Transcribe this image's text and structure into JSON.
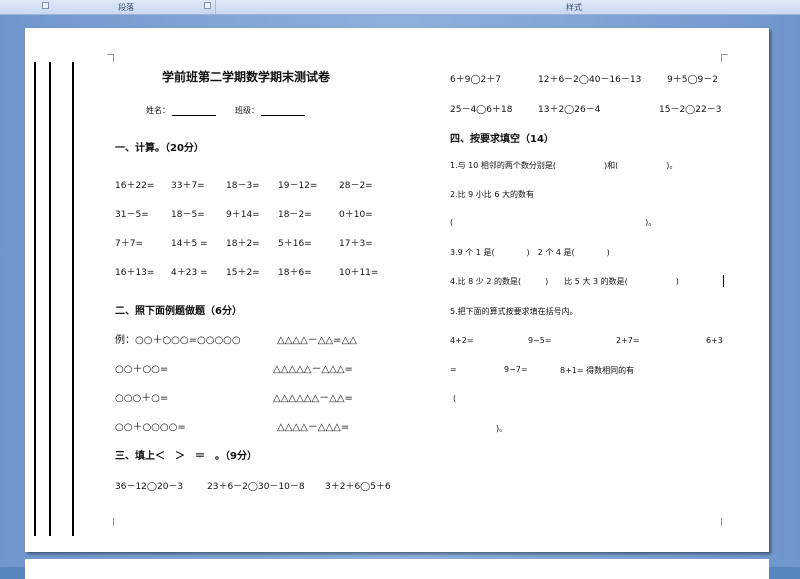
{
  "ribbon": {
    "group_paragraph": "段落",
    "group_styles": "样式"
  },
  "exam": {
    "title": "学前班第二学期数学期末测试卷",
    "name_label": "姓名：",
    "class_label": "班级：",
    "section1": {
      "heading": "一、计算。（20分）",
      "rows": [
        [
          "16＋22=",
          "33＋7=",
          "18－3=",
          "19－12=",
          "28－2="
        ],
        [
          "31－5=",
          "18－5=",
          "9＋14=",
          "18－2=",
          "0＋10="
        ],
        [
          "7＋7=",
          "14＋5 =",
          "18＋2=",
          "5＋16=",
          "17＋3="
        ],
        [
          "16＋13=",
          "4＋23 =",
          "15＋2=",
          "18＋6=",
          "10＋11="
        ]
      ]
    },
    "section2": {
      "heading": "二、照下面例题做题（6分）",
      "rows": [
        [
          "例：○○＋○○○=○○○○○",
          "△△△△－△△=△△"
        ],
        [
          "○○＋○○=",
          "△△△△△－△△△="
        ],
        [
          "○○○＋○=",
          "△△△△△△－△△="
        ],
        [
          "○○＋○○○○=",
          "△△△△－△△△="
        ]
      ]
    },
    "section3": {
      "heading": "三、填上＜　＞　＝　。（9分）",
      "row1": [
        "36－12◯20－3",
        "23＋6－2◯30－10－8",
        "3＋2＋6◯5＋6"
      ]
    },
    "right_compare": {
      "row1": [
        "6＋9◯2＋7",
        "12＋6－2◯40－16－13",
        "9＋5◯9－2"
      ],
      "row2": [
        "25－4◯6＋18",
        "13＋2◯26－4",
        "15－2◯22－3"
      ]
    },
    "section4": {
      "heading": "四、按要求填空（14）",
      "q1": "1.与 10 相邻的两个数分别是(　　　　　　)和(　　　　　　)。",
      "q2a": "2.比 9 小比 6 大的数有",
      "q2b": "(　　　　　　　　　　　　　　　　　　　　　　　　)。",
      "q3": "3.9 个 1 是(　　　　)　2 个 4 是(　　　　)",
      "q4": "4.比 8 少 2 的数是(　　　)　　比 5 大 3 的数是(　　　　　　)",
      "q5": "5.把下面的算式按要求填在括号内。",
      "q5_items": [
        "4+2=",
        "9−5=",
        "2+7=",
        "6+3"
      ],
      "q5_row2_start": "=",
      "q5_row2_items": [
        "9−7=",
        "8+1= 得数相同的有"
      ],
      "q5_paren_open": "(",
      "q5_paren_close": ")。"
    }
  }
}
